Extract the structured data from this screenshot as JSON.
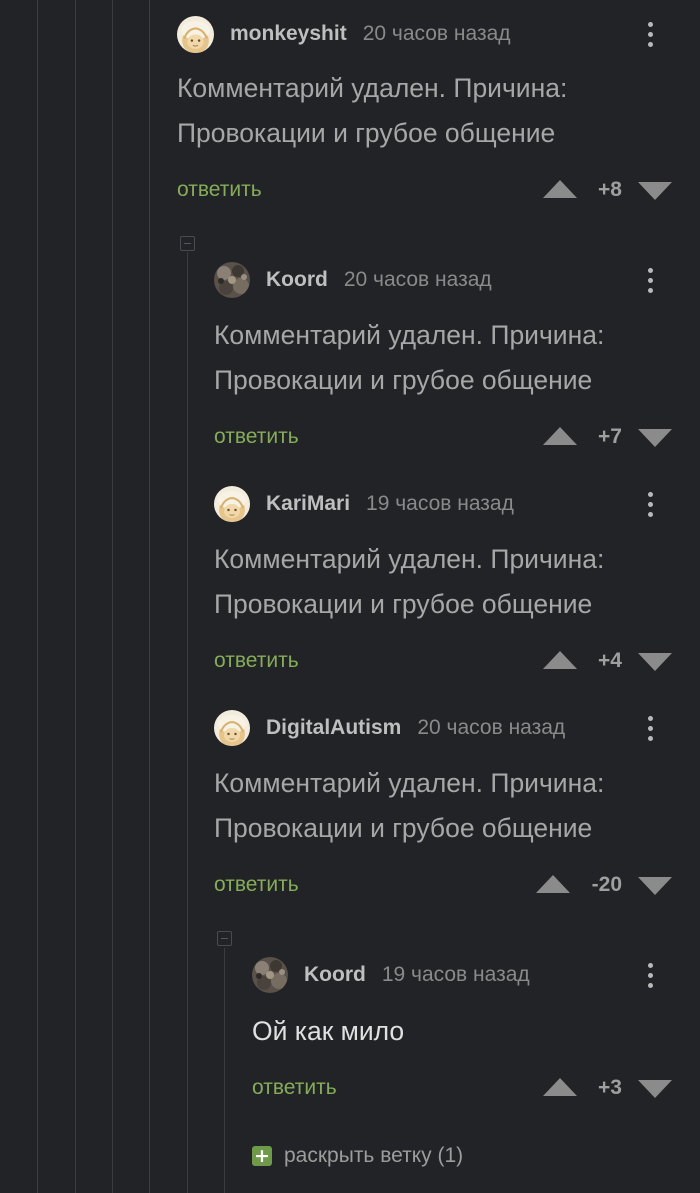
{
  "comments": [
    {
      "username": "monkeyshit",
      "time": "20 часов назад",
      "text_line1": "Комментарий удален. Причина:",
      "text_line2": "Провокации и грубое общение",
      "reply": "ответить",
      "score": "+8",
      "avatar": "blonde-avatar"
    },
    {
      "username": "Koord",
      "time": "20 часов назад",
      "text_line1": "Комментарий удален. Причина:",
      "text_line2": "Провокации и грубое общение",
      "reply": "ответить",
      "score": "+7",
      "avatar": "dark-photo-avatar"
    },
    {
      "username": "KariMari",
      "time": "19 часов назад",
      "text_line1": "Комментарий удален. Причина:",
      "text_line2": "Провокации и грубое общение",
      "reply": "ответить",
      "score": "+4",
      "avatar": "blonde-avatar"
    },
    {
      "username": "DigitalAutism",
      "time": "20 часов назад",
      "text_line1": "Комментарий удален. Причина:",
      "text_line2": "Провокации и грубое общение",
      "reply": "ответить",
      "score": "-20",
      "avatar": "blonde-avatar"
    },
    {
      "username": "Koord",
      "time": "19 часов назад",
      "text_line1": "Ой как мило",
      "reply": "ответить",
      "score": "+3",
      "avatar": "dark-photo-avatar"
    }
  ],
  "expand_branch": {
    "icon": "plus-icon",
    "label": "раскрыть ветку (1)"
  },
  "colors": {
    "background": "#222327",
    "reply_link": "#85ac58",
    "expand_icon": "#6e9a4a"
  }
}
